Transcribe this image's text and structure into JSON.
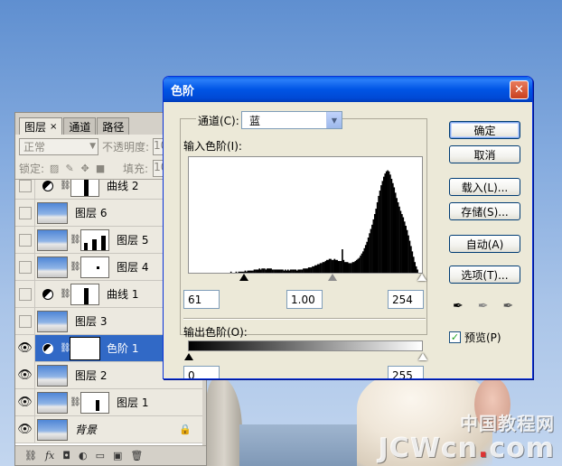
{
  "watermark": {
    "top": "中国教程网",
    "bottom_a": "JCWcn",
    "bottom_dot": ".",
    "bottom_b": "com"
  },
  "layers_panel": {
    "tabs": [
      {
        "label": "图层",
        "close": "×"
      },
      {
        "label": "通道"
      },
      {
        "label": "路径"
      }
    ],
    "blend_mode": "正常",
    "opacity_label": "不透明度:",
    "opacity_value": "10",
    "lock_label": "锁定:",
    "fill_label": "填充:",
    "fill_value": "10",
    "layers": [
      {
        "name": "曲线 2",
        "visible": false,
        "kind": "adjustment"
      },
      {
        "name": "图层 6",
        "visible": false,
        "kind": "image"
      },
      {
        "name": "图层 5",
        "visible": false,
        "kind": "image-mask"
      },
      {
        "name": "图层 4",
        "visible": false,
        "kind": "image-mask"
      },
      {
        "name": "曲线 1",
        "visible": false,
        "kind": "adjustment"
      },
      {
        "name": "图层 3",
        "visible": false,
        "kind": "image"
      },
      {
        "name": "色阶 1",
        "visible": true,
        "kind": "adjustment",
        "selected": true
      },
      {
        "name": "图层 2",
        "visible": true,
        "kind": "image"
      },
      {
        "name": "图层 1",
        "visible": true,
        "kind": "image-mask"
      },
      {
        "name": "背景",
        "visible": true,
        "kind": "background",
        "locked": true
      }
    ],
    "footer_icons": [
      "link-icon",
      "fx-icon",
      "mask-icon",
      "adjustment-icon",
      "folder-icon",
      "new-layer-icon",
      "trash-icon"
    ]
  },
  "levels_dialog": {
    "title": "色阶",
    "close": "✕",
    "channel_label": "通道(C):",
    "channel_value": "蓝",
    "input_levels_label": "输入色阶(I):",
    "input_black": "61",
    "input_gamma": "1.00",
    "input_white": "254",
    "output_levels_label": "输出色阶(O):",
    "output_black": "0",
    "output_white": "255",
    "buttons": {
      "ok": "确定",
      "cancel": "取消",
      "load": "载入(L)...",
      "save": "存储(S)...",
      "auto": "自动(A)",
      "options": "选项(T)..."
    },
    "preview_label": "预览(P)",
    "preview_checked": true,
    "histogram": [
      0,
      0,
      0,
      0,
      0,
      0,
      0,
      0,
      0,
      0,
      0,
      0,
      0,
      0,
      0,
      0,
      0,
      0,
      0,
      0,
      0,
      0,
      0,
      0,
      0,
      0,
      0,
      0,
      0,
      0,
      0,
      0,
      1,
      0,
      0,
      0,
      1,
      0,
      1,
      1,
      1,
      1,
      1,
      2,
      1,
      2,
      2,
      2,
      2,
      2,
      3,
      3,
      3,
      3,
      4,
      3,
      4,
      4,
      4,
      3,
      4,
      4,
      4,
      4,
      3,
      3,
      3,
      3,
      3,
      3,
      3,
      3,
      3,
      2,
      3,
      2,
      3,
      2,
      3,
      3,
      3,
      3,
      3,
      2,
      3,
      3,
      3,
      3,
      4,
      4,
      4,
      4,
      5,
      5,
      5,
      6,
      6,
      7,
      7,
      8,
      8,
      9,
      9,
      10,
      10,
      11,
      12,
      12,
      13,
      13,
      12,
      12,
      13,
      12,
      12,
      11,
      11,
      11,
      22,
      12,
      10,
      10,
      10,
      9,
      9,
      9,
      10,
      10,
      11,
      12,
      13,
      14,
      16,
      18,
      20,
      23,
      26,
      29,
      33,
      37,
      41,
      45,
      50,
      55,
      60,
      66,
      72,
      77,
      82,
      86,
      90,
      93,
      95,
      96,
      95,
      92,
      88,
      84,
      80,
      75,
      70,
      66,
      62,
      58,
      55,
      52,
      48,
      44,
      40,
      35,
      30,
      25,
      20,
      15,
      10,
      6,
      3,
      0,
      0,
      0
    ]
  }
}
